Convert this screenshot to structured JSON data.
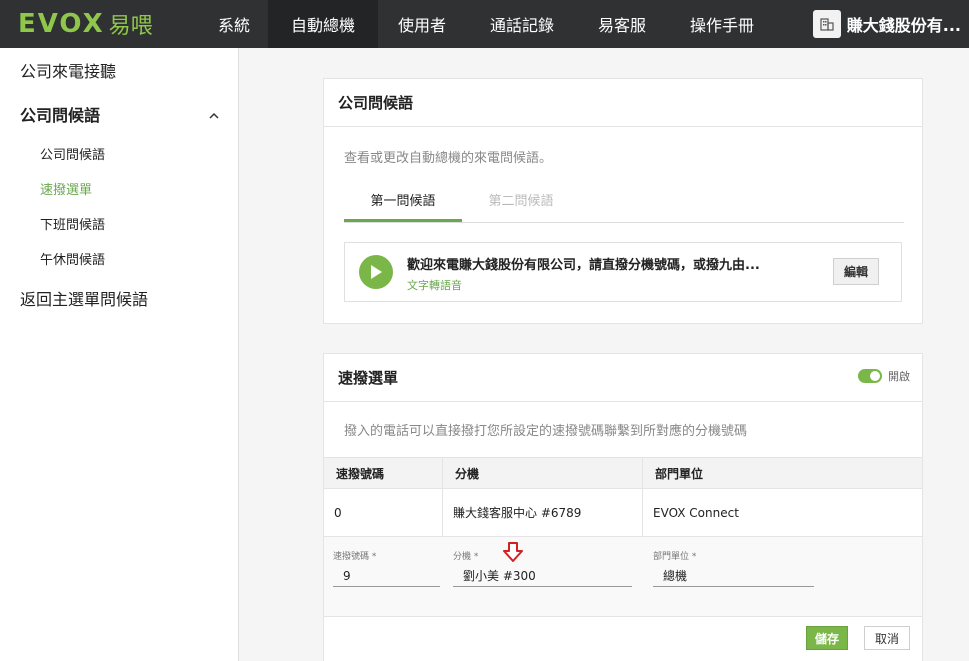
{
  "brand": {
    "logo_text": "EVOX",
    "logo_cn": "易喂",
    "logo_color": "#8fc74a"
  },
  "nav": {
    "items": [
      "系統",
      "自動總機",
      "使用者",
      "通話記錄",
      "易客服",
      "操作手冊"
    ],
    "active_index": 1,
    "company": "賺大錢股份有..."
  },
  "sidebar": {
    "item_top": "公司來電接聽",
    "group": "公司問候語",
    "sub_items": [
      "公司問候語",
      "速撥選單",
      "下班問候語",
      "午休問候語"
    ],
    "active_sub": "速撥選單",
    "item_bottom": "返回主選單問候語"
  },
  "greeting_card": {
    "title": "公司問候語",
    "desc": "查看或更改自動總機的來電問候語。",
    "tabs": [
      "第一問候語",
      "第二問候語"
    ],
    "message": "歡迎來電賺大錢股份有限公司，請直撥分機號碼，或撥九由...",
    "message_type": "文字轉語音",
    "edit_label": "編輯"
  },
  "speed_dial_card": {
    "title": "速撥選單",
    "toggle_label": "開啟",
    "toggle_on": true,
    "desc": "撥入的電話可以直接撥打您所設定的速撥號碼聯繫到所對應的分機號碼",
    "columns": [
      "速撥號碼",
      "分機",
      "部門單位"
    ],
    "rows": [
      {
        "code": "0",
        "ext": "賺大錢客服中心 #6789",
        "dept": "EVOX Connect"
      }
    ],
    "form": {
      "code_label": "速撥號碼 *",
      "code_value": "9",
      "ext_label": "分機 *",
      "ext_value": "劉小美 #300",
      "dept_label": "部門單位 *",
      "dept_value": "總機"
    },
    "save_label": "儲存",
    "cancel_label": "取消"
  }
}
